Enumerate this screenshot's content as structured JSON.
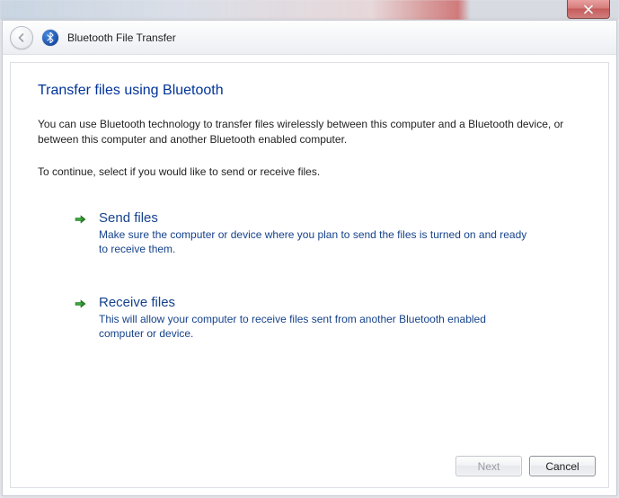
{
  "window": {
    "title": "Bluetooth File Transfer"
  },
  "page": {
    "heading": "Transfer files using Bluetooth",
    "intro": "You can use Bluetooth technology to transfer files wirelessly between this computer and a Bluetooth device, or between this computer and another Bluetooth enabled computer.",
    "instruction": "To continue, select if you would like to send or receive files."
  },
  "options": {
    "send": {
      "title": "Send files",
      "desc": "Make sure the computer or device where you plan to send the files is turned on and ready to receive them."
    },
    "receive": {
      "title": "Receive files",
      "desc": "This will allow your computer to receive files sent from another Bluetooth enabled computer or device."
    }
  },
  "buttons": {
    "next": "Next",
    "cancel": "Cancel"
  }
}
